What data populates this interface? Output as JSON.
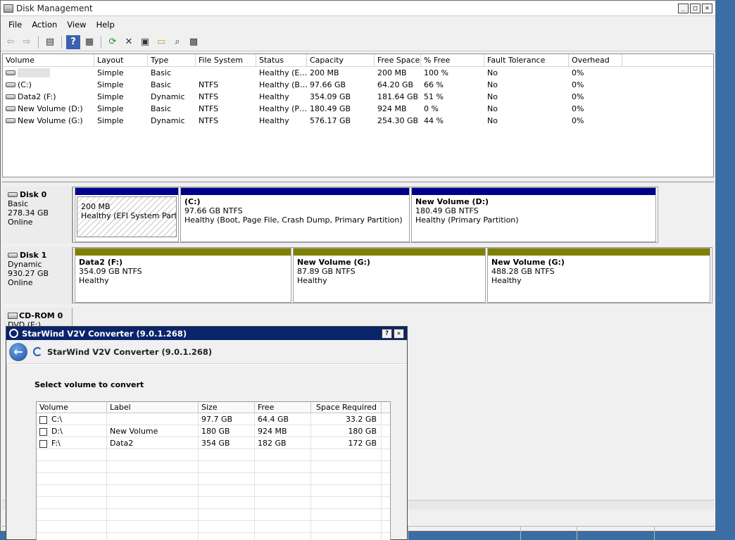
{
  "window": {
    "title": "Disk Management"
  },
  "menu": [
    "File",
    "Action",
    "View",
    "Help"
  ],
  "toolbar": [
    {
      "icon": "back-arrow-icon",
      "glyph": "⇦"
    },
    {
      "icon": "forward-arrow-icon",
      "glyph": "⇨"
    },
    {
      "icon": "show-hide-console-tree-icon",
      "glyph": "▤"
    },
    {
      "icon": "help-icon",
      "glyph": "?"
    },
    {
      "icon": "properties-icon",
      "glyph": "▦"
    },
    {
      "icon": "refresh-icon",
      "glyph": "⟳"
    },
    {
      "icon": "delete-icon",
      "glyph": "✕"
    },
    {
      "icon": "properties-sheet-icon",
      "glyph": "▣"
    },
    {
      "icon": "open-folder-icon",
      "glyph": "▭"
    },
    {
      "icon": "find-icon",
      "glyph": "⌕"
    },
    {
      "icon": "disk-settings-icon",
      "glyph": "▩"
    }
  ],
  "volume_list": {
    "columns": [
      "Volume",
      "Layout",
      "Type",
      "File System",
      "Status",
      "Capacity",
      "Free Space",
      "% Free",
      "Fault Tolerance",
      "Overhead"
    ],
    "rows": [
      {
        "volume": "",
        "layout": "Simple",
        "type": "Basic",
        "fs": "",
        "status": "Healthy (E…",
        "capacity": "200 MB",
        "free": "200 MB",
        "pct": "100 %",
        "fault": "No",
        "overhead": "0%"
      },
      {
        "volume": "(C:)",
        "layout": "Simple",
        "type": "Basic",
        "fs": "NTFS",
        "status": "Healthy (B…",
        "capacity": "97.66 GB",
        "free": "64.20 GB",
        "pct": "66 %",
        "fault": "No",
        "overhead": "0%"
      },
      {
        "volume": "Data2 (F:)",
        "layout": "Simple",
        "type": "Dynamic",
        "fs": "NTFS",
        "status": "Healthy",
        "capacity": "354.09 GB",
        "free": "181.64 GB",
        "pct": "51 %",
        "fault": "No",
        "overhead": "0%"
      },
      {
        "volume": "New Volume (D:)",
        "layout": "Simple",
        "type": "Basic",
        "fs": "NTFS",
        "status": "Healthy (P…",
        "capacity": "180.49 GB",
        "free": "924 MB",
        "pct": "0 %",
        "fault": "No",
        "overhead": "0%"
      },
      {
        "volume": "New Volume (G:)",
        "layout": "Simple",
        "type": "Dynamic",
        "fs": "NTFS",
        "status": "Healthy",
        "capacity": "576.17 GB",
        "free": "254.30 GB",
        "pct": "44 %",
        "fault": "No",
        "overhead": "0%"
      }
    ]
  },
  "disks": [
    {
      "name": "Disk 0",
      "type": "Basic",
      "size": "278.34 GB",
      "state": "Online",
      "partitions": [
        {
          "name": "",
          "size": "200 MB",
          "status": "Healthy (EFI System Partitio",
          "color": "#00008b"
        },
        {
          "name": "(C:)",
          "size": "97.66 GB NTFS",
          "status": "Healthy (Boot, Page File, Crash Dump, Primary Partition)",
          "color": "#00008b"
        },
        {
          "name": "New Volume  (D:)",
          "size": "180.49 GB NTFS",
          "status": "Healthy (Primary Partition)",
          "color": "#00008b"
        }
      ]
    },
    {
      "name": "Disk 1",
      "type": "Dynamic",
      "size": "930.27 GB",
      "state": "Online",
      "partitions": [
        {
          "name": "Data2  (F:)",
          "size": "354.09 GB NTFS",
          "status": "Healthy",
          "color": "#808000"
        },
        {
          "name": "New Volume  (G:)",
          "size": "87.89 GB NTFS",
          "status": "Healthy",
          "color": "#808000"
        },
        {
          "name": "New Volume  (G:)",
          "size": "488.28 GB NTFS",
          "status": "Healthy",
          "color": "#808000"
        }
      ]
    },
    {
      "name": "CD-ROM 0",
      "type": "DVD (E:)"
    }
  ],
  "dialog": {
    "title": "StarWind V2V Converter (9.0.1.268)",
    "header_title": "StarWind V2V Converter (9.0.1.268)",
    "help_label": "?",
    "close_label": "✕",
    "prompt": "Select volume to convert",
    "columns": [
      "Volume",
      "Label",
      "Size",
      "Free",
      "Space Required"
    ],
    "rows": [
      {
        "volume": "C:\\",
        "label": "",
        "size": "97.7 GB",
        "free": "64.4 GB",
        "required": "33.2 GB",
        "checked": false
      },
      {
        "volume": "D:\\",
        "label": "New Volume",
        "size": "180 GB",
        "free": "924 MB",
        "required": "180 GB",
        "checked": false
      },
      {
        "volume": "F:\\",
        "label": "Data2",
        "size": "354 GB",
        "free": "182 GB",
        "required": "172 GB",
        "checked": false
      }
    ]
  }
}
